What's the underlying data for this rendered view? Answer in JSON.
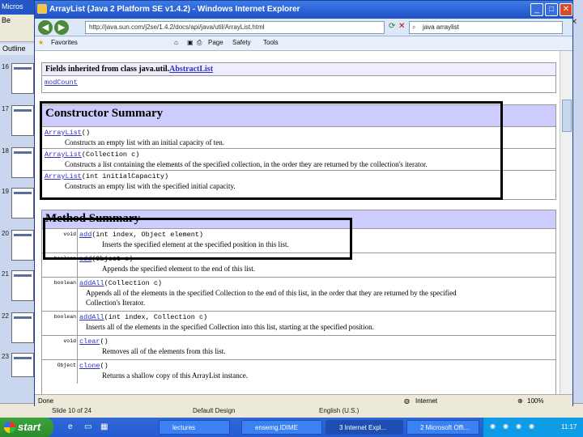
{
  "ppt": {
    "title": "Micros",
    "menu": "Be",
    "outline_tab": "Outline",
    "slide_numbers": [
      "16",
      "17",
      "18",
      "19",
      "20",
      "21",
      "22",
      "23"
    ],
    "status_slide": "Slide 10 of 24",
    "status_design": "Default Design",
    "status_lang": "English (U.S.)"
  },
  "ie": {
    "title": "ArrayList (Java 2 Platform SE v1.4.2) - Windows Internet Explorer",
    "address": "http://java.sun.com/j2se/1.4.2/docs/api/java/util/ArrayList.html",
    "search": "java arraylist",
    "toolbar": {
      "favorites": "Favorites",
      "page": "Page",
      "safety": "Safety",
      "tools": "Tools"
    },
    "status": {
      "left": "Done",
      "zone": "Internet",
      "zoom": "100%"
    }
  },
  "content": {
    "inherited_header": "Fields inherited from class java.util.",
    "inherited_class": "AbstractList",
    "inherited_field": "modCount",
    "constructor_header": "Constructor Summary",
    "constructors": [
      {
        "name": "ArrayList",
        "params": "()",
        "desc": "Constructs an empty list with an initial capacity of ten."
      },
      {
        "name": "ArrayList",
        "params": "(Collection c)",
        "desc": "Constructs a list containing the elements of the specified collection, in the order they are returned by the collection's iterator."
      },
      {
        "name": "ArrayList",
        "params": "(int initialCapacity)",
        "desc": "Constructs an empty list with the specified initial capacity."
      }
    ],
    "method_header": "Method Summary",
    "methods": [
      {
        "type": "void",
        "name": "add",
        "params": "(int index, Object element)",
        "desc": "Inserts the specified element at the specified position in this list.",
        "desc2": ""
      },
      {
        "type": "boolean",
        "name": "add",
        "params": "(Object o)",
        "desc": "Appends the specified element to the end of this list.",
        "desc2": ""
      },
      {
        "type": "boolean",
        "name": "addAll",
        "params": "(Collection c)",
        "desc": "Appends all of the elements in the specified Collection to the end of this list, in the order that they are returned by the specified",
        "desc2": "Collection's Iterator."
      },
      {
        "type": "boolean",
        "name": "addAll",
        "params": "(int index, Collection c)",
        "desc": "Inserts all of the elements in the specified Collection into this list, starting at the specified position.",
        "desc2": ""
      },
      {
        "type": "void",
        "name": "clear",
        "params": "()",
        "desc": "Removes all of the elements from this list.",
        "desc2": ""
      },
      {
        "type": "Object",
        "name": "clone",
        "params": "()",
        "desc": "Returns a shallow copy of this ArrayList instance.",
        "desc2": ""
      }
    ]
  },
  "taskbar": {
    "start": "start",
    "tasks": [
      "lectures",
      "ensemg.IDIME",
      "3 Internet Expl...",
      "2 Microsoft Offi..."
    ],
    "clock": "11:17"
  }
}
